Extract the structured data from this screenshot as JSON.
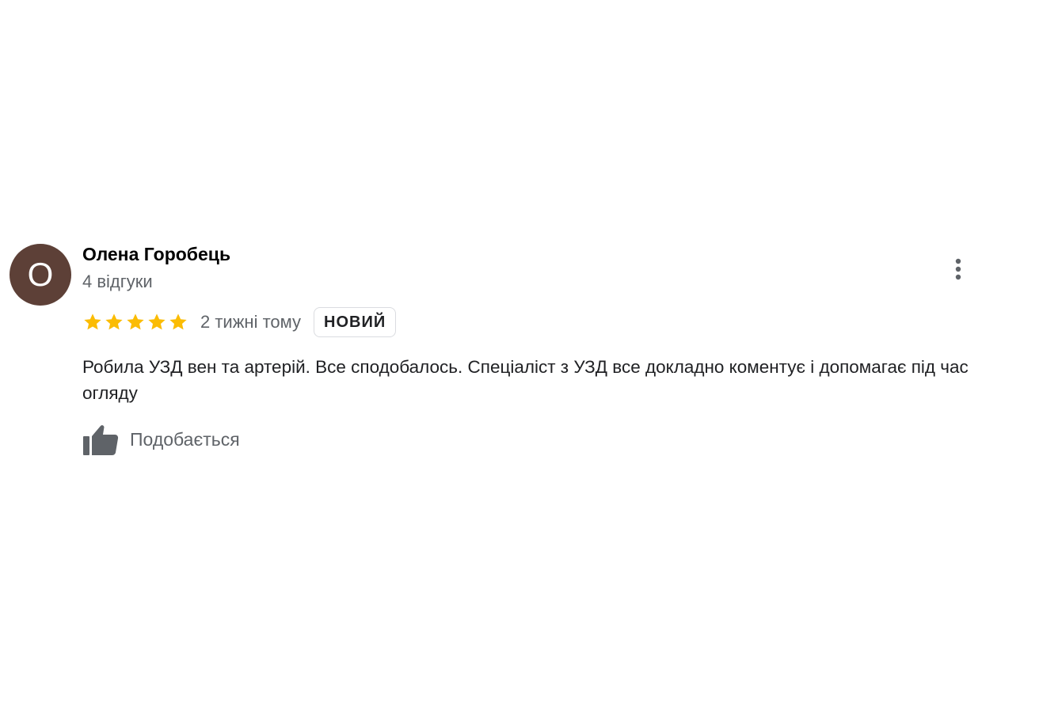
{
  "review": {
    "avatar_letter": "О",
    "avatar_color": "#5d4037",
    "author_name": "Олена Горобець",
    "review_count": "4 відгуки",
    "rating": 5,
    "rating_max": 5,
    "star_color": "#fbbc04",
    "date": "2 тижні тому",
    "badge": "НОВИЙ",
    "text": "Робила УЗД вен та артерій. Все сподобалось. Спеціаліст з УЗД все докладно коментує і допомагає під час огляду",
    "like_label": "Подобається",
    "like_icon": "thumbs-up-icon",
    "more_icon": "more-vert-icon"
  }
}
